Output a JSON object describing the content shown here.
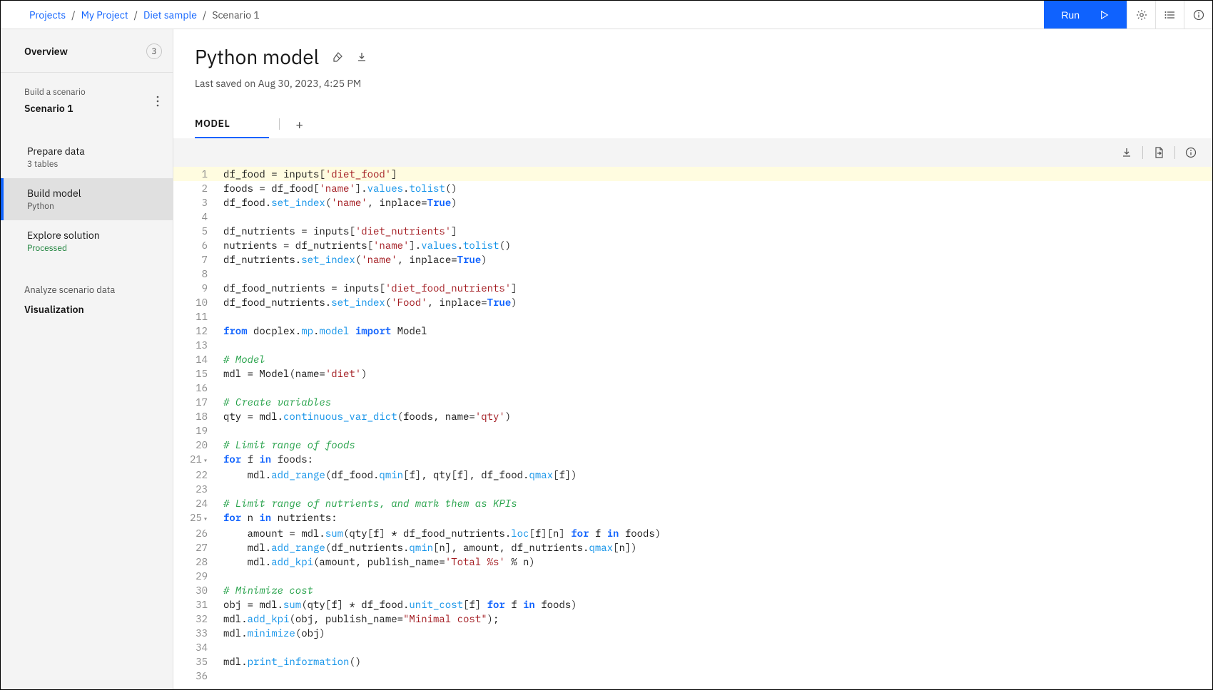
{
  "breadcrumbs": {
    "items": [
      "Projects",
      "My Project",
      "Diet sample"
    ],
    "current": "Scenario 1"
  },
  "topbar": {
    "run_label": "Run"
  },
  "sidebar": {
    "overview_label": "Overview",
    "badge": "3",
    "scenario_label": "Build a scenario",
    "scenario_value": "Scenario 1",
    "items": [
      {
        "title": "Prepare data",
        "sub": "3 tables",
        "active": false,
        "sub_class": ""
      },
      {
        "title": "Build model",
        "sub": "Python",
        "active": true,
        "sub_class": ""
      },
      {
        "title": "Explore solution",
        "sub": "Processed",
        "active": false,
        "sub_class": "green"
      }
    ],
    "analyze_label": "Analyze scenario data",
    "viz_label": "Visualization"
  },
  "content": {
    "title": "Python model",
    "saved": "Last saved on Aug 30, 2023, 4:25 PM",
    "tab_label": "MODEL"
  },
  "code": {
    "lines": [
      {
        "n": 1,
        "hl": true,
        "fold": false,
        "tokens": [
          [
            "",
            "df_food = inputs["
          ],
          [
            "str",
            "'diet_food'"
          ],
          [
            "",
            "]"
          ]
        ]
      },
      {
        "n": 2,
        "hl": false,
        "fold": false,
        "tokens": [
          [
            "",
            "foods = df_food["
          ],
          [
            "str",
            "'name'"
          ],
          [
            "",
            "]."
          ],
          [
            "fn",
            "values"
          ],
          [
            "",
            "."
          ],
          [
            "fn",
            "tolist"
          ],
          [
            "",
            "()"
          ]
        ]
      },
      {
        "n": 3,
        "hl": false,
        "fold": false,
        "tokens": [
          [
            "",
            "df_food."
          ],
          [
            "fn",
            "set_index"
          ],
          [
            "",
            "("
          ],
          [
            "str",
            "'name'"
          ],
          [
            "",
            ", inplace="
          ],
          [
            "bool",
            "True"
          ],
          [
            "",
            ")"
          ]
        ]
      },
      {
        "n": 4,
        "hl": false,
        "fold": false,
        "tokens": [
          [
            "",
            ""
          ]
        ]
      },
      {
        "n": 5,
        "hl": false,
        "fold": false,
        "tokens": [
          [
            "",
            "df_nutrients = inputs["
          ],
          [
            "str",
            "'diet_nutrients'"
          ],
          [
            "",
            "]"
          ]
        ]
      },
      {
        "n": 6,
        "hl": false,
        "fold": false,
        "tokens": [
          [
            "",
            "nutrients = df_nutrients["
          ],
          [
            "str",
            "'name'"
          ],
          [
            "",
            "]."
          ],
          [
            "fn",
            "values"
          ],
          [
            "",
            "."
          ],
          [
            "fn",
            "tolist"
          ],
          [
            "",
            "()"
          ]
        ]
      },
      {
        "n": 7,
        "hl": false,
        "fold": false,
        "tokens": [
          [
            "",
            "df_nutrients."
          ],
          [
            "fn",
            "set_index"
          ],
          [
            "",
            "("
          ],
          [
            "str",
            "'name'"
          ],
          [
            "",
            ", inplace="
          ],
          [
            "bool",
            "True"
          ],
          [
            "",
            ")"
          ]
        ]
      },
      {
        "n": 8,
        "hl": false,
        "fold": false,
        "tokens": [
          [
            "",
            ""
          ]
        ]
      },
      {
        "n": 9,
        "hl": false,
        "fold": false,
        "tokens": [
          [
            "",
            "df_food_nutrients = inputs["
          ],
          [
            "str",
            "'diet_food_nutrients'"
          ],
          [
            "",
            "]"
          ]
        ]
      },
      {
        "n": 10,
        "hl": false,
        "fold": false,
        "tokens": [
          [
            "",
            "df_food_nutrients."
          ],
          [
            "fn",
            "set_index"
          ],
          [
            "",
            "("
          ],
          [
            "str",
            "'Food'"
          ],
          [
            "",
            ", inplace="
          ],
          [
            "bool",
            "True"
          ],
          [
            "",
            ")"
          ]
        ]
      },
      {
        "n": 11,
        "hl": false,
        "fold": false,
        "tokens": [
          [
            "",
            ""
          ]
        ]
      },
      {
        "n": 12,
        "hl": false,
        "fold": false,
        "tokens": [
          [
            "kw",
            "from"
          ],
          [
            "",
            " docplex."
          ],
          [
            "fn",
            "mp"
          ],
          [
            "",
            "."
          ],
          [
            "fn",
            "model"
          ],
          [
            "",
            " "
          ],
          [
            "kw",
            "import"
          ],
          [
            "",
            " Model"
          ]
        ]
      },
      {
        "n": 13,
        "hl": false,
        "fold": false,
        "tokens": [
          [
            "",
            ""
          ]
        ]
      },
      {
        "n": 14,
        "hl": false,
        "fold": false,
        "tokens": [
          [
            "com",
            "# Model"
          ]
        ]
      },
      {
        "n": 15,
        "hl": false,
        "fold": false,
        "tokens": [
          [
            "",
            "mdl = Model(name="
          ],
          [
            "str",
            "'diet'"
          ],
          [
            "",
            ")"
          ]
        ]
      },
      {
        "n": 16,
        "hl": false,
        "fold": false,
        "tokens": [
          [
            "",
            ""
          ]
        ]
      },
      {
        "n": 17,
        "hl": false,
        "fold": false,
        "tokens": [
          [
            "com",
            "# Create variables"
          ]
        ]
      },
      {
        "n": 18,
        "hl": false,
        "fold": false,
        "tokens": [
          [
            "",
            "qty = mdl."
          ],
          [
            "fn",
            "continuous_var_dict"
          ],
          [
            "",
            "(foods, name="
          ],
          [
            "str",
            "'qty'"
          ],
          [
            "",
            ")"
          ]
        ]
      },
      {
        "n": 19,
        "hl": false,
        "fold": false,
        "tokens": [
          [
            "",
            ""
          ]
        ]
      },
      {
        "n": 20,
        "hl": false,
        "fold": false,
        "tokens": [
          [
            "com",
            "# Limit range of foods"
          ]
        ]
      },
      {
        "n": 21,
        "hl": false,
        "fold": true,
        "tokens": [
          [
            "kw",
            "for"
          ],
          [
            "",
            " f "
          ],
          [
            "kw",
            "in"
          ],
          [
            "",
            " foods:"
          ]
        ]
      },
      {
        "n": 22,
        "hl": false,
        "fold": false,
        "tokens": [
          [
            "",
            "    mdl."
          ],
          [
            "fn",
            "add_range"
          ],
          [
            "",
            "(df_food."
          ],
          [
            "fn",
            "qmin"
          ],
          [
            "",
            "[f], qty[f], df_food."
          ],
          [
            "fn",
            "qmax"
          ],
          [
            "",
            "[f])"
          ]
        ]
      },
      {
        "n": 23,
        "hl": false,
        "fold": false,
        "tokens": [
          [
            "",
            ""
          ]
        ]
      },
      {
        "n": 24,
        "hl": false,
        "fold": false,
        "tokens": [
          [
            "com",
            "# Limit range of nutrients, and mark them as KPIs"
          ]
        ]
      },
      {
        "n": 25,
        "hl": false,
        "fold": true,
        "tokens": [
          [
            "kw",
            "for"
          ],
          [
            "",
            " n "
          ],
          [
            "kw",
            "in"
          ],
          [
            "",
            " nutrients:"
          ]
        ]
      },
      {
        "n": 26,
        "hl": false,
        "fold": false,
        "tokens": [
          [
            "",
            "    amount = mdl."
          ],
          [
            "fn",
            "sum"
          ],
          [
            "",
            "(qty[f] * df_food_nutrients."
          ],
          [
            "fn",
            "loc"
          ],
          [
            "",
            "[f][n] "
          ],
          [
            "kw",
            "for"
          ],
          [
            "",
            " f "
          ],
          [
            "kw",
            "in"
          ],
          [
            "",
            " foods)"
          ]
        ]
      },
      {
        "n": 27,
        "hl": false,
        "fold": false,
        "tokens": [
          [
            "",
            "    mdl."
          ],
          [
            "fn",
            "add_range"
          ],
          [
            "",
            "(df_nutrients."
          ],
          [
            "fn",
            "qmin"
          ],
          [
            "",
            "[n], amount, df_nutrients."
          ],
          [
            "fn",
            "qmax"
          ],
          [
            "",
            "[n])"
          ]
        ]
      },
      {
        "n": 28,
        "hl": false,
        "fold": false,
        "tokens": [
          [
            "",
            "    mdl."
          ],
          [
            "fn",
            "add_kpi"
          ],
          [
            "",
            "(amount, publish_name="
          ],
          [
            "str",
            "'Total %s'"
          ],
          [
            "",
            " % n)"
          ]
        ]
      },
      {
        "n": 29,
        "hl": false,
        "fold": false,
        "tokens": [
          [
            "",
            ""
          ]
        ]
      },
      {
        "n": 30,
        "hl": false,
        "fold": false,
        "tokens": [
          [
            "com",
            "# Minimize cost"
          ]
        ]
      },
      {
        "n": 31,
        "hl": false,
        "fold": false,
        "tokens": [
          [
            "",
            "obj = mdl."
          ],
          [
            "fn",
            "sum"
          ],
          [
            "",
            "(qty[f] * df_food."
          ],
          [
            "fn",
            "unit_cost"
          ],
          [
            "",
            "[f] "
          ],
          [
            "kw",
            "for"
          ],
          [
            "",
            " f "
          ],
          [
            "kw",
            "in"
          ],
          [
            "",
            " foods)"
          ]
        ]
      },
      {
        "n": 32,
        "hl": false,
        "fold": false,
        "tokens": [
          [
            "",
            "mdl."
          ],
          [
            "fn",
            "add_kpi"
          ],
          [
            "",
            "(obj, publish_name="
          ],
          [
            "str",
            "\"Minimal cost\""
          ],
          [
            "",
            ");"
          ]
        ]
      },
      {
        "n": 33,
        "hl": false,
        "fold": false,
        "tokens": [
          [
            "",
            "mdl."
          ],
          [
            "fn",
            "minimize"
          ],
          [
            "",
            "(obj)"
          ]
        ]
      },
      {
        "n": 34,
        "hl": false,
        "fold": false,
        "tokens": [
          [
            "",
            ""
          ]
        ]
      },
      {
        "n": 35,
        "hl": false,
        "fold": false,
        "tokens": [
          [
            "",
            "mdl."
          ],
          [
            "fn",
            "print_information"
          ],
          [
            "",
            "()"
          ]
        ]
      },
      {
        "n": 36,
        "hl": false,
        "fold": false,
        "tokens": [
          [
            "",
            ""
          ]
        ]
      }
    ]
  }
}
